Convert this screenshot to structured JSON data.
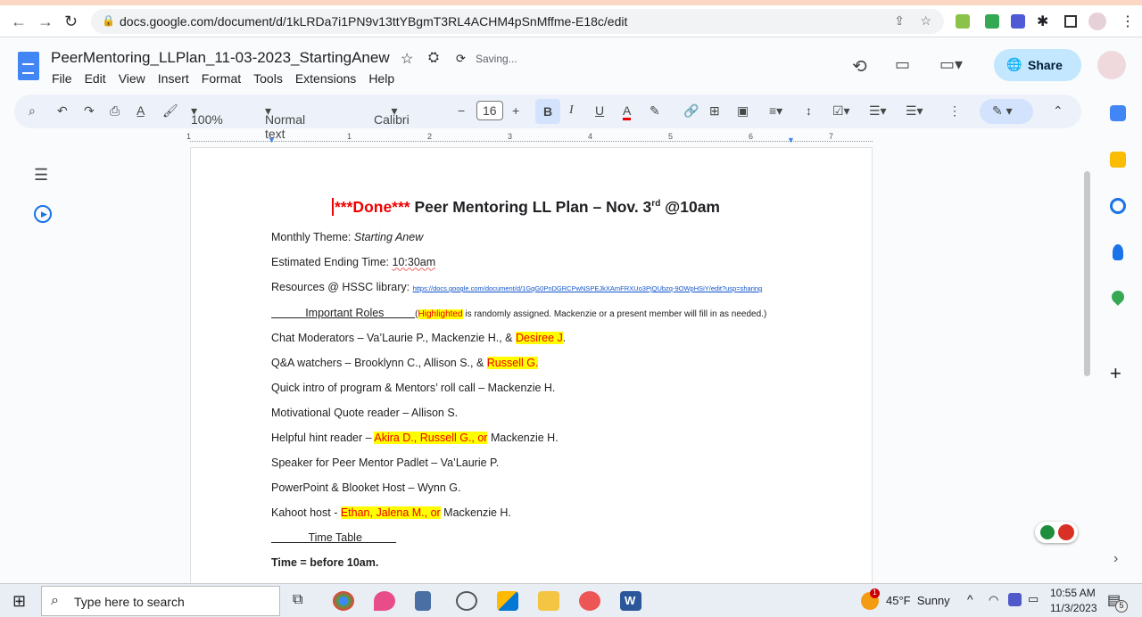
{
  "browser": {
    "url": "docs.google.com/document/d/1kLRDa7i1PN9v13ttYBgmT3RL4ACHM4pSnMffme-E18c/edit"
  },
  "docs": {
    "title": "PeerMentoring_LLPlan_11-03-2023_StartingAnew",
    "status": "Saving...",
    "menu": [
      "File",
      "Edit",
      "View",
      "Insert",
      "Format",
      "Tools",
      "Extensions",
      "Help"
    ],
    "share_label": "Share"
  },
  "toolbar": {
    "zoom": "100%",
    "style": "Normal text",
    "font": "Calibri",
    "font_size": "16"
  },
  "ruler": [
    "1",
    "1",
    "2",
    "3",
    "4",
    "5",
    "6",
    "7"
  ],
  "document": {
    "title_done": "***Done***",
    "title_rest": " Peer Mentoring LL Plan – Nov. 3",
    "title_sup": "rd",
    "title_end": " @10am",
    "theme_label": "Monthly Theme: ",
    "theme_value": "Starting Anew",
    "ending_label": "Estimated Ending Time: ",
    "ending_value": "10:30am",
    "resources_label": "Resources @ HSSC library: ",
    "resources_link": "https://docs.google.com/document/d/1GqG0PnDGRCPwNSPEJkXAmFRXUo3PjQUbzq-9OWpHSiY/edit?usp=sharing",
    "roles_heading": "           Important Roles          ",
    "roles_note_hl": "Highlighted",
    "roles_note": " is randomly assigned. Mackenzie or a present member will fill in as needed.)",
    "chat_pre": "Chat Moderators – Va’Laurie P., Mackenzie H., & ",
    "chat_hl": "Desiree J",
    "chat_post": ".",
    "qa_pre": "Q&A watchers – Brooklynn C., Allison S., & ",
    "qa_hl": "Russell G.",
    "intro": "Quick intro of program & Mentors’ roll call – Mackenzie H.",
    "quote": "Motivational Quote reader – Allison S.",
    "hint_pre": "Helpful hint reader – ",
    "hint_hl": "Akira D., Russell G., or",
    "hint_post": " Mackenzie H.",
    "padlet": "Speaker for Peer Mentor Padlet – Va’Laurie P.",
    "ppt": "PowerPoint & Blooket Host – Wynn G.",
    "kahoot_pre": "Kahoot host - ",
    "kahoot_hl": "Ethan, Jalena M., or",
    "kahoot_post": " Mackenzie H.",
    "timetable": "            Time Table           ",
    "time": "Time = before 10am."
  },
  "taskbar": {
    "search_placeholder": "Type here to search",
    "weather": "45°F  Sunny",
    "weather_badge": "1",
    "time": "10:55 AM",
    "date": "11/3/2023",
    "notif": "5"
  }
}
